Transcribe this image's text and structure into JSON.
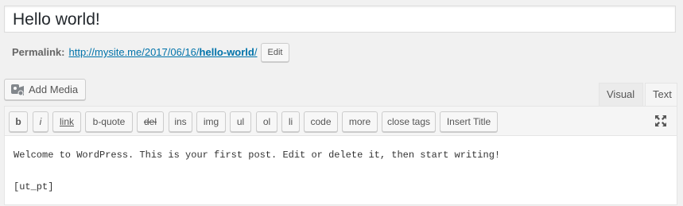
{
  "post": {
    "title": "Hello world!"
  },
  "permalink": {
    "label": "Permalink:",
    "url_prefix": "http://mysite.me/2017/06/16/",
    "slug": "hello-world",
    "url_suffix": "/",
    "edit_label": "Edit"
  },
  "media": {
    "add_label": "Add Media",
    "icon": "media-camera-icon"
  },
  "tabs": {
    "visual": "Visual",
    "text": "Text"
  },
  "toolbar": {
    "buttons": [
      "b",
      "i",
      "link",
      "b-quote",
      "del",
      "ins",
      "img",
      "ul",
      "ol",
      "li",
      "code",
      "more",
      "close tags",
      "Insert Title"
    ],
    "fullscreen_icon": "fullscreen-expand-icon"
  },
  "editor": {
    "line1": "Welcome to WordPress. This is your first post. Edit or delete it, then start writing!",
    "line2": "",
    "line3": "[ut_pt]"
  },
  "colors": {
    "link": "#0073aa",
    "background": "#f1f1f1"
  }
}
